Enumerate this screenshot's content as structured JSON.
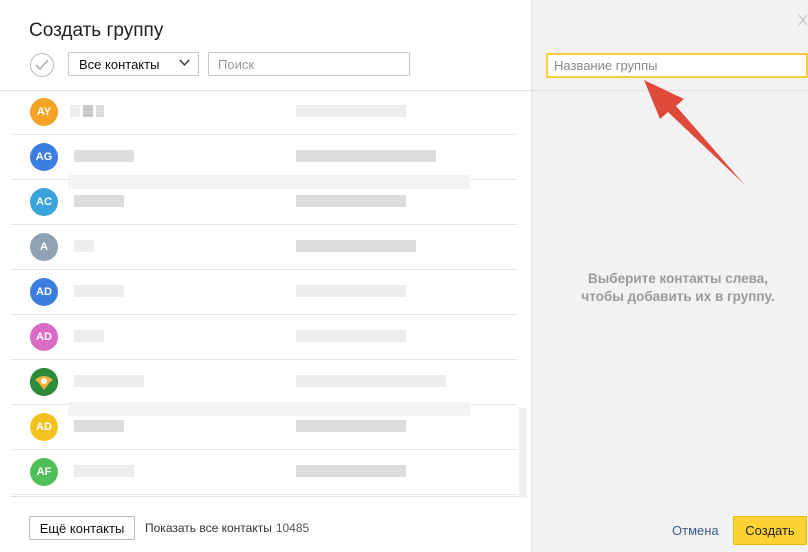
{
  "dialog": {
    "title": "Создать группу",
    "filter_label": "Все контакты",
    "search_placeholder": "Поиск"
  },
  "contacts": [
    {
      "initials": "AY",
      "color": "#f4a325"
    },
    {
      "initials": "AG",
      "color": "#3c7de0"
    },
    {
      "initials": "AC",
      "color": "#3aa3dc"
    },
    {
      "initials": "A",
      "color": "#8ea2b3"
    },
    {
      "initials": "AD",
      "color": "#3c7de0"
    },
    {
      "initials": "AD",
      "color": "#d96bc4"
    },
    {
      "initials": "",
      "color": "#2e8b3c",
      "icon": "photo-avatar-icon"
    },
    {
      "initials": "AD",
      "color": "#f2c01f"
    },
    {
      "initials": "AF",
      "color": "#4fbf58"
    }
  ],
  "footer": {
    "more_button": "Ещё контакты",
    "show_all": "Показать все контакты",
    "count": "10485"
  },
  "right": {
    "group_name_placeholder": "Название группы",
    "hint": "Выберите контакты слева, чтобы добавить их в группу.",
    "cancel": "Отмена",
    "create": "Создать"
  },
  "colors": {
    "accent": "#ffd233",
    "arrow": "#e04a3a",
    "link": "#3c5d8f"
  }
}
